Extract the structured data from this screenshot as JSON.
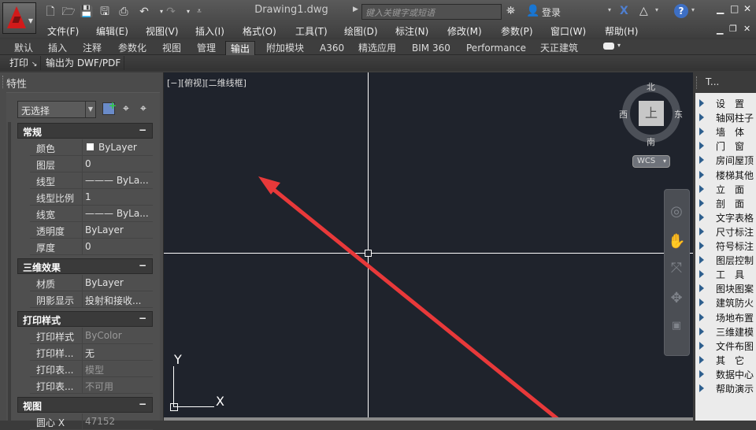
{
  "app": {
    "document_title": "Drawing1.dwg",
    "search_placeholder": "键入关键字或短语",
    "login_label": "登录",
    "quick_access": [
      "new-icon",
      "open-icon",
      "save-icon",
      "save-as-icon",
      "plot-icon",
      "undo-icon",
      "redo-icon",
      "customize-icon"
    ]
  },
  "menu": [
    "文件(F)",
    "编辑(E)",
    "视图(V)",
    "插入(I)",
    "格式(O)",
    "工具(T)",
    "绘图(D)",
    "标注(N)",
    "修改(M)",
    "参数(P)",
    "窗口(W)",
    "帮助(H)"
  ],
  "ribbon": {
    "tabs": [
      "默认",
      "插入",
      "注释",
      "参数化",
      "视图",
      "管理",
      "输出",
      "附加模块",
      "A360",
      "精选应用",
      "BIM 360",
      "Performance",
      "天正建筑"
    ],
    "active_tab": "输出",
    "panels": [
      "打印",
      "输出为 DWF/PDF"
    ]
  },
  "properties": {
    "title": "特性",
    "selection": "无选择",
    "sections": [
      {
        "name": "常规",
        "toggle": "−",
        "rows": [
          {
            "key": "颜色",
            "value": "ByLayer"
          },
          {
            "key": "图层",
            "value": "0"
          },
          {
            "key": "线型",
            "value": "——— ByLa..."
          },
          {
            "key": "线型比例",
            "value": "1"
          },
          {
            "key": "线宽",
            "value": "——— ByLa..."
          },
          {
            "key": "透明度",
            "value": "ByLayer"
          },
          {
            "key": "厚度",
            "value": "0"
          }
        ]
      },
      {
        "name": "三维效果",
        "toggle": "−",
        "rows": [
          {
            "key": "材质",
            "value": "ByLayer"
          },
          {
            "key": "阴影显示",
            "value": "投射和接收..."
          }
        ]
      },
      {
        "name": "打印样式",
        "toggle": "−",
        "rows": [
          {
            "key": "打印样式",
            "value": "ByColor"
          },
          {
            "key": "打印样...",
            "value": "无"
          },
          {
            "key": "打印表...",
            "value": "模型"
          },
          {
            "key": "打印表...",
            "value": "不可用"
          }
        ]
      },
      {
        "name": "视图",
        "toggle": "−",
        "rows": [
          {
            "key": "圆心 X",
            "value": "47152"
          }
        ]
      }
    ]
  },
  "viewport": {
    "label": "[−][俯视][二维线框]",
    "viewcube": {
      "top": "上",
      "north": "北",
      "south": "南",
      "east": "东",
      "west": "西",
      "wcs": "WCS"
    },
    "ucs": {
      "x": "X",
      "y": "Y"
    },
    "annotation_color": "#e8393a"
  },
  "tianzheng": {
    "title": "T...",
    "items": [
      "设　置",
      "轴网柱子",
      "墙　体",
      "门　窗",
      "房间屋顶",
      "楼梯其他",
      "立　面",
      "剖　面",
      "文字表格",
      "尺寸标注",
      "符号标注",
      "图层控制",
      "工　具",
      "图块图案",
      "建筑防火",
      "场地布置",
      "三维建模",
      "文件布图",
      "其　它",
      "数据中心",
      "帮助演示"
    ]
  }
}
